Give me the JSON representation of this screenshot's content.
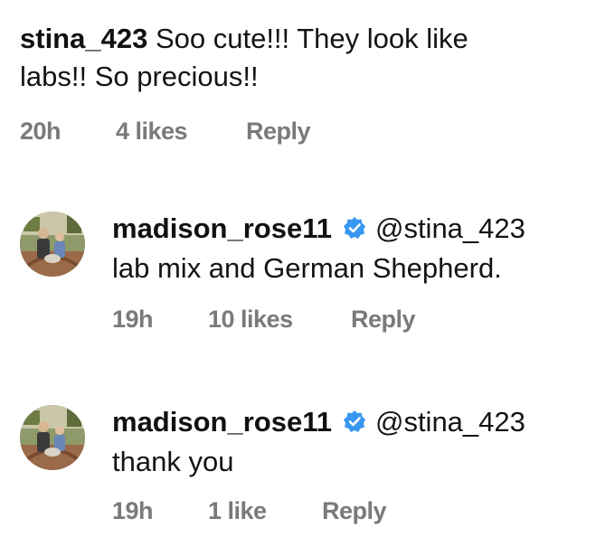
{
  "comments": [
    {
      "username": "stina_423",
      "text_line1": "Soo cute!!! They look like",
      "text_line2": "labs!! So precious!!",
      "time": "20h",
      "likes": "4 likes",
      "reply": "Reply"
    },
    {
      "username": "madison_rose11",
      "mention": "@stina_423",
      "text": "lab mix and German Shepherd.",
      "time": "19h",
      "likes": "10 likes",
      "reply": "Reply",
      "avatar_icon": "profile-photo"
    },
    {
      "username": "madison_rose11",
      "mention": "@stina_423",
      "text": "thank you",
      "time": "19h",
      "likes": "1 like",
      "reply": "Reply",
      "avatar_icon": "profile-photo"
    }
  ],
  "colors": {
    "verified_badge": "#3897f0",
    "meta_text": "#7a7a7a"
  }
}
